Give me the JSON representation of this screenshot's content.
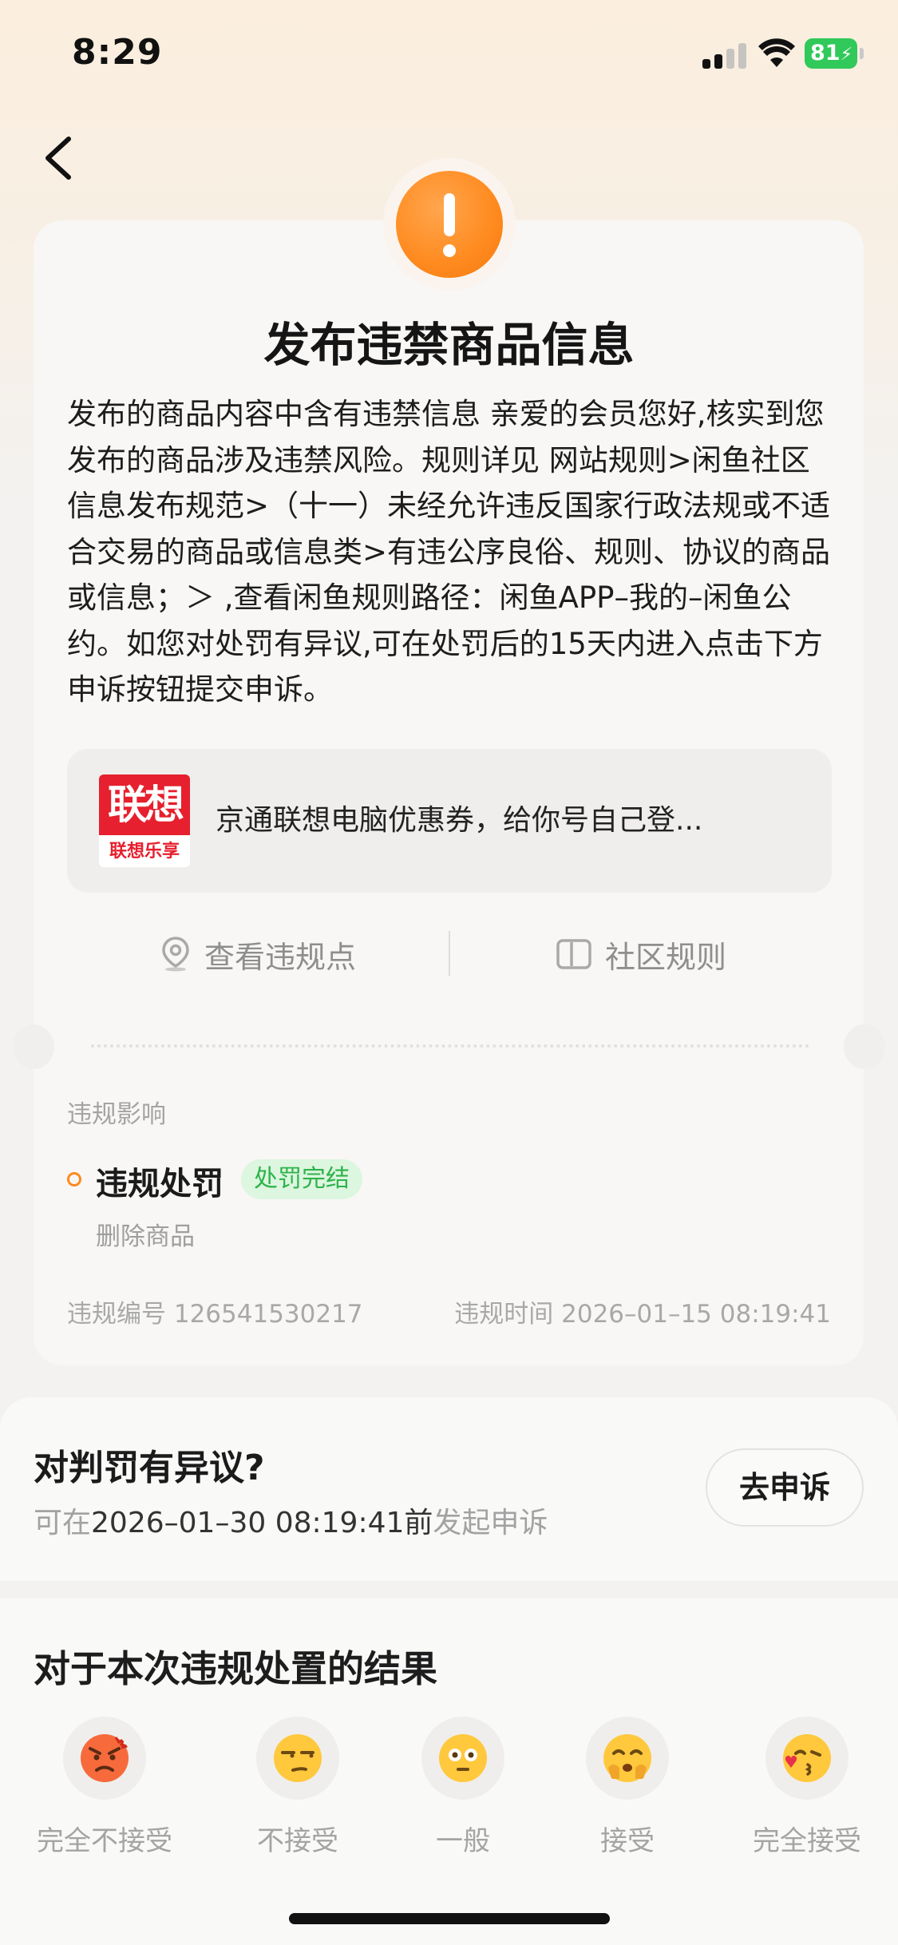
{
  "status_bar": {
    "time": "8:29",
    "battery": "81"
  },
  "header": {
    "back_icon": "chevron-left-icon"
  },
  "violation": {
    "alert_icon": "exclamation-icon",
    "title": "发布违禁商品信息",
    "description": "发布的商品内容中含有违禁信息 亲爱的会员您好,核实到您发布的商品涉及违禁风险。规则详见 网站规则>闲鱼社区信息发布规范>（十一）未经允许违反国家行政法规或不适合交易的商品或信息类>有违公序良俗、规则、协议的商品或信息；＞ ,查看闲鱼规则路径：闲鱼APP–我的–闲鱼公约。如您对处罚有异议,可在处罚后的15天内进入点击下方申诉按钮提交申诉。",
    "product": {
      "logo_main": "联想",
      "logo_sub": "联想乐享",
      "title": "京通联想电脑优惠券，给你号自己登..."
    },
    "actions": {
      "view_points": "查看违规点",
      "community_rules": "社区规则"
    },
    "impact_label": "违规影响",
    "penalty": {
      "title": "违规处罚",
      "status": "处罚完结",
      "detail": "删除商品"
    },
    "violation_id": "违规编号 126541530217",
    "violation_time": "违规时间 2026–01–15 08:19:41"
  },
  "appeal": {
    "title": "对判罚有异议?",
    "prefix": "可在",
    "deadline": "2026–01–30 08:19:41前",
    "suffix": "发起申诉",
    "button": "去申诉"
  },
  "feedback": {
    "title": "对于本次违规处置的结果",
    "options": [
      {
        "label": "完全不接受",
        "icon": "angry-face-icon"
      },
      {
        "label": "不接受",
        "icon": "unamused-face-icon"
      },
      {
        "label": "一般",
        "icon": "neutral-face-icon"
      },
      {
        "label": "接受",
        "icon": "smiling-face-icon"
      },
      {
        "label": "完全接受",
        "icon": "kissing-face-icon"
      }
    ]
  },
  "colors": {
    "accent_orange": "#ff8a1f",
    "status_green": "#2fb24b",
    "battery_green": "#30c95a",
    "lenovo_red": "#e6202e"
  }
}
